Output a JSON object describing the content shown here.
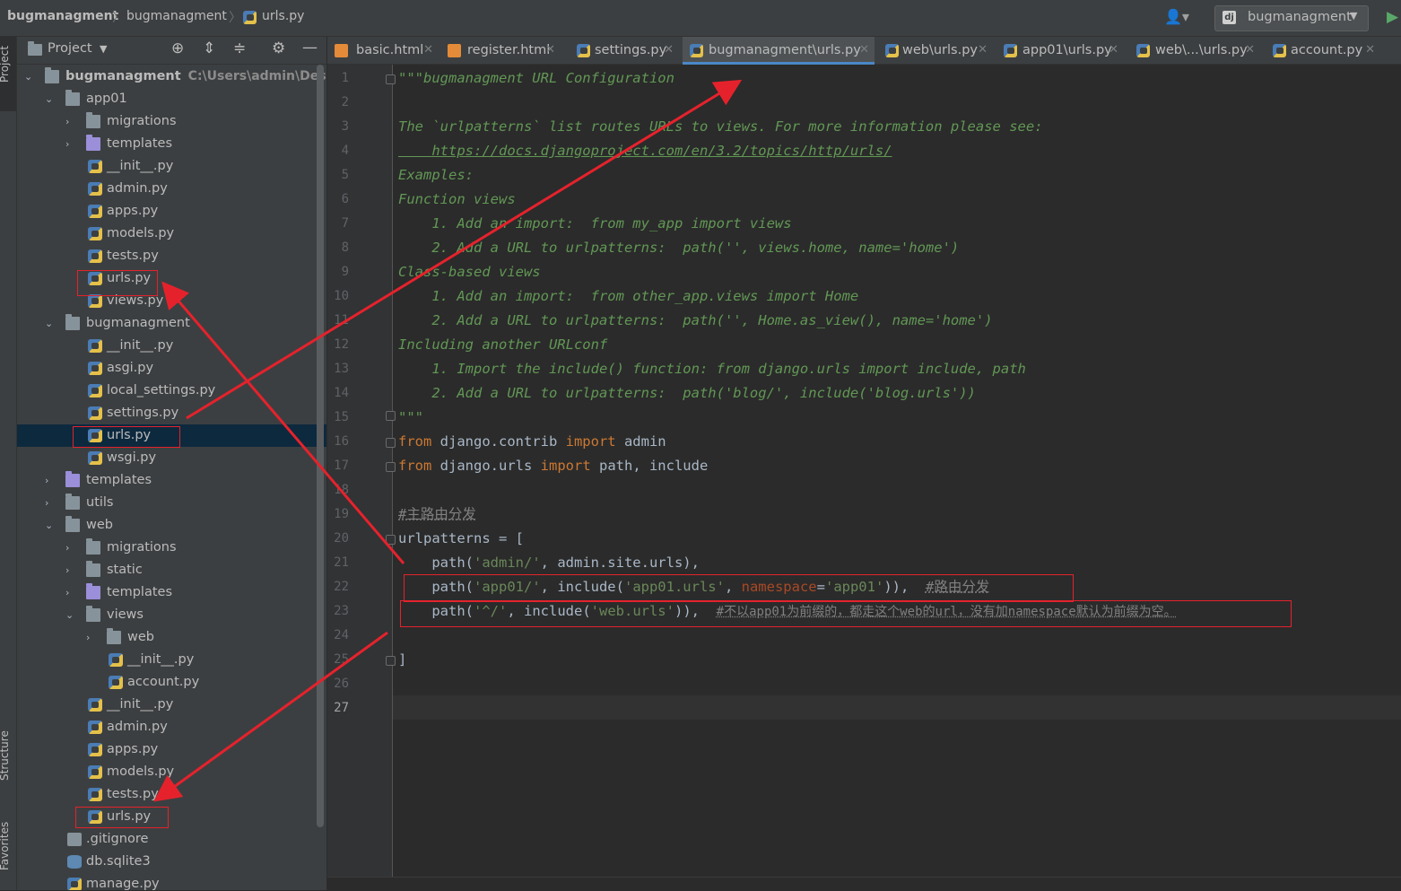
{
  "navbar": {
    "crumbs": [
      "bugmanagment",
      "bugmanagment",
      "urls.py"
    ],
    "run_config": "bugmanagment"
  },
  "side_stripe": {
    "project": "Project",
    "structure": "Structure",
    "favorites": "Favorites"
  },
  "project_panel": {
    "title": "Project",
    "root_name": "bugmanagment",
    "root_path": "C:\\Users\\admin\\Desktop\\",
    "items": [
      {
        "label": "app01",
        "type": "folder"
      },
      {
        "label": "migrations",
        "type": "folder"
      },
      {
        "label": "templates",
        "type": "folder-purple"
      },
      {
        "label": "__init__.py",
        "type": "py"
      },
      {
        "label": "admin.py",
        "type": "py"
      },
      {
        "label": "apps.py",
        "type": "py"
      },
      {
        "label": "models.py",
        "type": "py"
      },
      {
        "label": "tests.py",
        "type": "py"
      },
      {
        "label": "urls.py",
        "type": "py"
      },
      {
        "label": "views.py",
        "type": "py"
      },
      {
        "label": "bugmanagment",
        "type": "folder"
      },
      {
        "label": "__init__.py",
        "type": "py"
      },
      {
        "label": "asgi.py",
        "type": "py"
      },
      {
        "label": "local_settings.py",
        "type": "py"
      },
      {
        "label": "settings.py",
        "type": "py"
      },
      {
        "label": "urls.py",
        "type": "py"
      },
      {
        "label": "wsgi.py",
        "type": "py"
      },
      {
        "label": "templates",
        "type": "folder-purple"
      },
      {
        "label": "utils",
        "type": "folder"
      },
      {
        "label": "web",
        "type": "folder"
      },
      {
        "label": "migrations",
        "type": "folder"
      },
      {
        "label": "static",
        "type": "folder"
      },
      {
        "label": "templates",
        "type": "folder-purple"
      },
      {
        "label": "views",
        "type": "folder"
      },
      {
        "label": "web",
        "type": "folder"
      },
      {
        "label": "__init__.py",
        "type": "py"
      },
      {
        "label": "account.py",
        "type": "py"
      },
      {
        "label": "__init__.py",
        "type": "py"
      },
      {
        "label": "admin.py",
        "type": "py"
      },
      {
        "label": "apps.py",
        "type": "py"
      },
      {
        "label": "models.py",
        "type": "py"
      },
      {
        "label": "tests.py",
        "type": "py"
      },
      {
        "label": "urls.py",
        "type": "py"
      },
      {
        "label": ".gitignore",
        "type": "git"
      },
      {
        "label": "db.sqlite3",
        "type": "db"
      },
      {
        "label": "manage.py",
        "type": "py"
      }
    ]
  },
  "tabs": [
    {
      "label": "basic.html",
      "icon": "html-icon"
    },
    {
      "label": "register.html",
      "icon": "html-icon"
    },
    {
      "label": "settings.py",
      "icon": "python-file-icon"
    },
    {
      "label": "bugmanagment\\urls.py",
      "icon": "python-file-icon",
      "active": true
    },
    {
      "label": "web\\urls.py",
      "icon": "python-file-icon"
    },
    {
      "label": "app01\\urls.py",
      "icon": "python-file-icon"
    },
    {
      "label": "web\\...\\urls.py",
      "icon": "python-file-icon"
    },
    {
      "label": "account.py",
      "icon": "python-file-icon"
    }
  ],
  "editor": {
    "current_line": "27",
    "line_numbers": [
      "1",
      "2",
      "3",
      "4",
      "5",
      "6",
      "7",
      "8",
      "9",
      "10",
      "11",
      "12",
      "13",
      "14",
      "15",
      "16",
      "17",
      "18",
      "19",
      "20",
      "21",
      "22",
      "23",
      "24",
      "25",
      "26",
      "27"
    ],
    "lines": {
      "l1": "\"\"\"bugmanagment URL Configuration",
      "l3": "The `urlpatterns` list routes URLs to views. For more information please see:",
      "l4": "    https://docs.djangoproject.com/en/3.2/topics/http/urls/",
      "l5": "Examples:",
      "l6": "Function views",
      "l7": "    1. Add an import:  from my_app import views",
      "l8": "    2. Add a URL to urlpatterns:  path('', views.home, name='home')",
      "l9": "Class-based views",
      "l10": "    1. Add an import:  from other_app.views import Home",
      "l11": "    2. Add a URL to urlpatterns:  path('', Home.as_view(), name='home')",
      "l12": "Including another URLconf",
      "l13": "    1. Import the include() function: from django.urls import include, path",
      "l14": "    2. Add a URL to urlpatterns:  path('blog/', include('blog.urls'))",
      "l15": "\"\"\"",
      "l16_kw1": "from",
      "l16_mod": " django.contrib ",
      "l16_kw2": "import",
      "l16_rest": " admin",
      "l17_kw1": "from",
      "l17_mod": " django.urls ",
      "l17_kw2": "import",
      "l17_rest": " path, include",
      "l19": "#主路由分发",
      "l20": "urlpatterns = [",
      "l21_a": "    path(",
      "l21_s": "'admin/'",
      "l21_b": ", admin.site.urls),",
      "l22_a": "    path(",
      "l22_s1": "'app01/'",
      "l22_b": ", include(",
      "l22_s2": "'app01.urls'",
      "l22_c": ", ",
      "l22_p": "namespace",
      "l22_d": "=",
      "l22_s3": "'app01'",
      "l22_e": ")),  ",
      "l22_cmt": "#路由分发",
      "l23_a": "    path(",
      "l23_s1": "'^/'",
      "l23_b": ", include(",
      "l23_s2": "'web.urls'",
      "l23_c": ")),  ",
      "l23_cmt": "#不以app01为前缀的，都走这个web的url，没有加namespace默认为前缀为空。",
      "l25": "]"
    }
  },
  "colors": {
    "annotation": "#e5222c",
    "keyword": "#cc7832",
    "string": "#6a8759",
    "docstring": "#629755",
    "selection": "#0d293e"
  }
}
